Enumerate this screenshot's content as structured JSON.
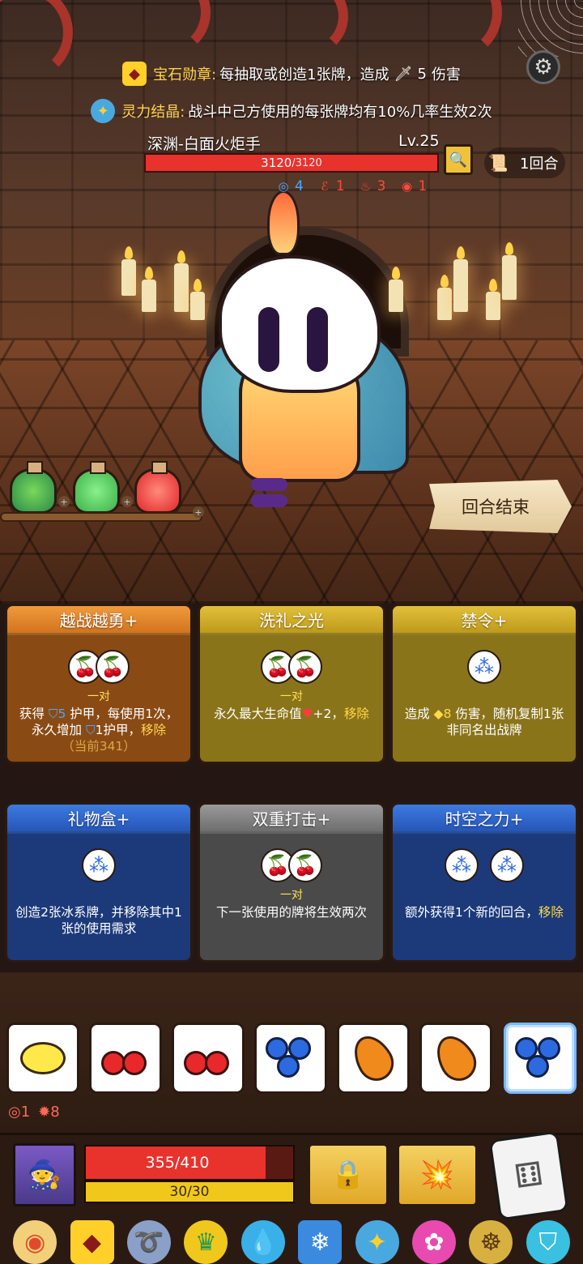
{
  "relics_top": [
    {
      "name": "宝石勋章:",
      "desc": "每抽取或创造1张牌，造成",
      "dmg_icon": "sword-icon",
      "dmg_value": "5",
      "dmg_unit": "伤害",
      "icon": "gem-medal-icon"
    },
    {
      "name": "灵力结晶:",
      "desc": "战斗中己方使用的每张牌均有10%几率生效2次",
      "icon": "spirit-crystal-icon"
    }
  ],
  "enemy": {
    "name": "深渊-白面火炬手",
    "level": "Lv.25",
    "hp_current": "3120",
    "hp_max": "/3120",
    "hp_fraction": 1.0,
    "statuses": [
      {
        "icon": "spiral-shield-icon",
        "value": "4",
        "color": "#4aa8ff"
      },
      {
        "icon": "tentacle-icon",
        "value": "1",
        "color": "#ff4a3a"
      },
      {
        "icon": "flame-icon",
        "value": "3",
        "color": "#ff4a3a"
      },
      {
        "icon": "vortex-icon",
        "value": "1",
        "color": "#ff4a3a"
      }
    ]
  },
  "turn": {
    "label": "1回合"
  },
  "end_turn_label": "回合结束",
  "cards": [
    {
      "title": "越战越勇+",
      "color": "orange",
      "requirements": [
        "cherry",
        "cherry"
      ],
      "req_label": "一对",
      "desc_parts": {
        "a": "获得 ",
        "armor_val": "5",
        "b": " 护甲，每使用1次，永久增加 ",
        "armor_val2": "1",
        "c": "护甲，",
        "remove": "移除",
        "current": "（当前341）"
      }
    },
    {
      "title": "洗礼之光",
      "color": "gold",
      "requirements": [
        "cherry",
        "cherry"
      ],
      "req_label": "一对",
      "desc_parts": {
        "a": "永久最大生命值",
        "heart": "♥",
        "b": "+2，",
        "remove": "移除"
      }
    },
    {
      "title": "禁令+",
      "color": "gold",
      "requirements": [
        "blueberry"
      ],
      "req_label": "",
      "desc_parts": {
        "a": "造成 ",
        "dmg": "8",
        "b": " 伤害，随机复制1张非同名出战牌"
      }
    },
    {
      "title": "礼物盒+",
      "color": "blue",
      "requirements": [
        "blueberry"
      ],
      "req_label": "",
      "desc": "创造2张冰系牌，并移除其中1张的使用需求"
    },
    {
      "title": "双重打击+",
      "color": "gray",
      "requirements": [
        "cherry",
        "cherry"
      ],
      "req_label": "一对",
      "desc": "下一张使用的牌将生效两次"
    },
    {
      "title": "时空之力+",
      "color": "blue",
      "requirements": [
        "blueberry",
        "blueberry"
      ],
      "req_label": "",
      "desc_parts": {
        "a": "额外获得1个新的回合，",
        "remove": "移除"
      }
    }
  ],
  "dice": [
    "lemon",
    "cherry",
    "cherry",
    "blueberry",
    "orange",
    "orange",
    "blueberry"
  ],
  "mini_stats": [
    {
      "icon": "vortex-icon",
      "value": "1"
    },
    {
      "icon": "gear-burst-icon",
      "value": "8"
    }
  ],
  "player": {
    "hp_text": "355/410",
    "hp_fraction": 0.866,
    "energy_text": "30/30",
    "energy_fraction": 1.0
  },
  "relic_bar": [
    "donut-shield-icon",
    "gem-medal-icon",
    "cornucopia-icon",
    "flame-crown-icon",
    "water-drop-icon",
    "ice-cube-icon",
    "spirit-crystal-icon",
    "pink-swirl-icon",
    "golden-beetle-icon",
    "blue-shield-icon"
  ]
}
